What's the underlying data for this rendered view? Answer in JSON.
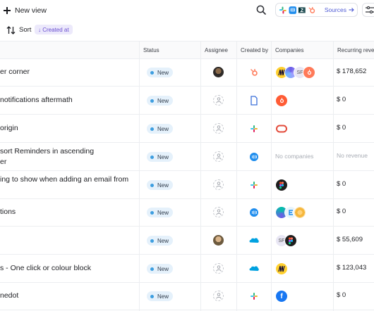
{
  "toolbar": {
    "new_view_label": "New view",
    "sources_label": "Sources",
    "source_icons": [
      "slack-icon",
      "intercom-icon",
      "zendesk-icon",
      "hubspot-icon"
    ]
  },
  "sort": {
    "label": "Sort",
    "chip_label": "↓ Created at"
  },
  "columns": [
    "Status",
    "Assignee",
    "Created by",
    "Companies",
    "Recurring reven"
  ],
  "rows": [
    {
      "title": "er corner",
      "status": "New",
      "assignee": "avatar",
      "creator": "hubspot-icon",
      "companies": [
        "miro-logo",
        "colorful-logo",
        "SF",
        "hubspot-logo"
      ],
      "revenue": "$ 178,652"
    },
    {
      "title": "notifications aftermath",
      "status": "New",
      "assignee": "empty",
      "creator": "document-icon",
      "companies": [
        "hubspot-logo"
      ],
      "revenue": "$ 0"
    },
    {
      "title": "origin",
      "status": "New",
      "assignee": "empty",
      "creator": "slack-icon",
      "companies": [
        "oval-logo"
      ],
      "revenue": "$ 0"
    },
    {
      "title_lines": [
        "sort Reminders in ascending",
        "er"
      ],
      "status": "New",
      "assignee": "empty",
      "creator": "intercom-icon",
      "companies_text": "No companies",
      "revenue": "No revenue"
    },
    {
      "title_lines": [
        "ing to show when adding an email from",
        ""
      ],
      "status": "New",
      "assignee": "empty",
      "creator": "slack-icon",
      "companies": [
        "figma-logo"
      ],
      "revenue": "$ 0"
    },
    {
      "title": "tions",
      "status": "New",
      "assignee": "empty",
      "creator": "intercom-icon",
      "companies": [
        "colorful-logo",
        "e-logo",
        "sunburst-logo"
      ],
      "revenue": "$ 0"
    },
    {
      "title": "",
      "status": "New",
      "assignee": "avatar",
      "creator": "salesforce-icon",
      "companies": [
        "SF",
        "figma-logo"
      ],
      "revenue": "$ 55,609"
    },
    {
      "title": "s - One click or colour block",
      "status": "New",
      "assignee": "empty",
      "creator": "salesforce-icon",
      "companies": [
        "miro-logo"
      ],
      "revenue": "$ 123,043"
    },
    {
      "title": "nedot",
      "status": "New",
      "assignee": "empty",
      "creator": "slack-icon",
      "companies": [
        "facebook-logo"
      ],
      "revenue": "$ 0"
    }
  ],
  "colors": {
    "accent": "#4f5bd5",
    "chip_bg": "#ece9fb",
    "chip_text": "#6a4fd0",
    "status_bg": "#e5f1fb",
    "status_dot": "#3d9ee0",
    "hubspot": "#ff7a59",
    "intercom": "#1f8ded"
  }
}
